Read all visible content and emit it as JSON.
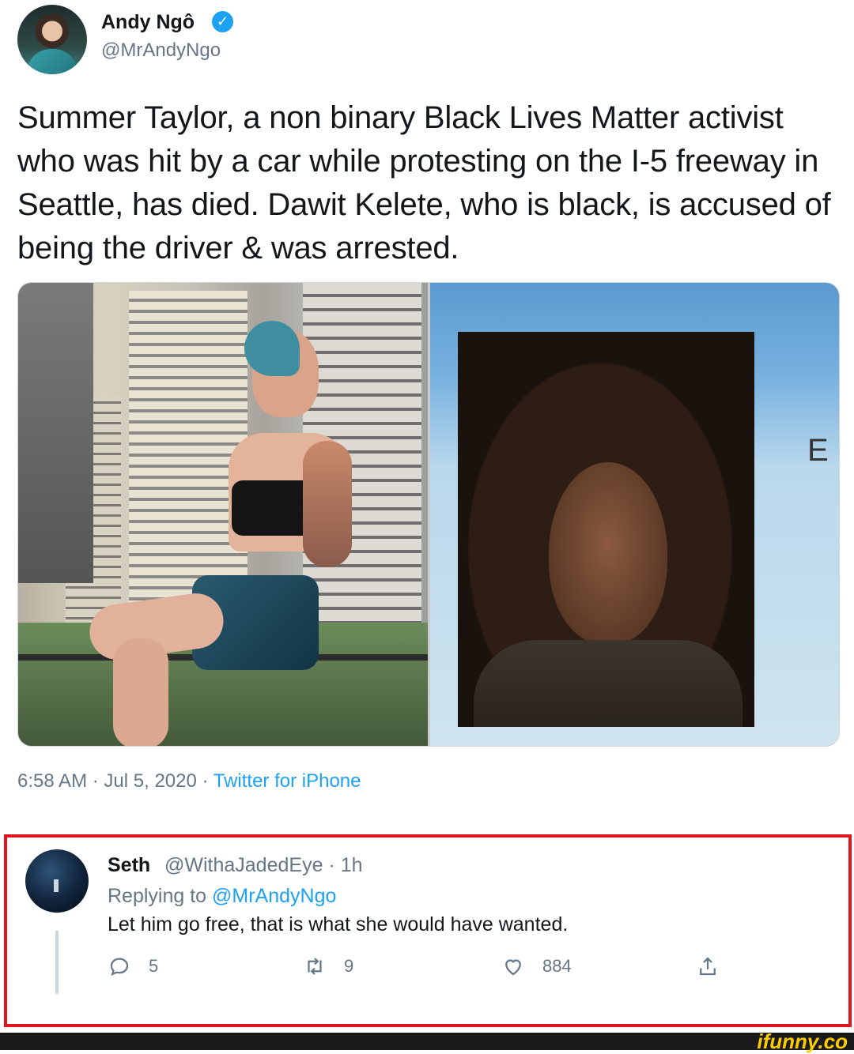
{
  "tweet": {
    "author_name": "Andy Ngô",
    "author_handle": "@MrAndyNgo",
    "verified_mark": "✓",
    "text": "Summer Taylor, a non binary Black Lives Matter activist who was hit by a car while protesting on the I-5 freeway in Seattle, has died. Dawit Kelete, who is black, is accused of being the driver & was arrested.",
    "time": "6:58 AM",
    "separator": "·",
    "date": "Jul 5, 2020",
    "source": "Twitter for iPhone",
    "id_card_letter": "E"
  },
  "reply": {
    "name": "Seth",
    "handle_time": "@WithaJadedEye · 1h",
    "replying_label": "Replying to",
    "replying_handle": "@MrAndyNgo",
    "text": "Let him go free, that is what she would have wanted.",
    "reply_count": "5",
    "retweet_count": "9",
    "like_count": "884"
  },
  "watermark": "ifunny.co",
  "colors": {
    "accent": "#1da1f2",
    "highlight_border": "#e0141e",
    "secondary_text": "#657786"
  }
}
